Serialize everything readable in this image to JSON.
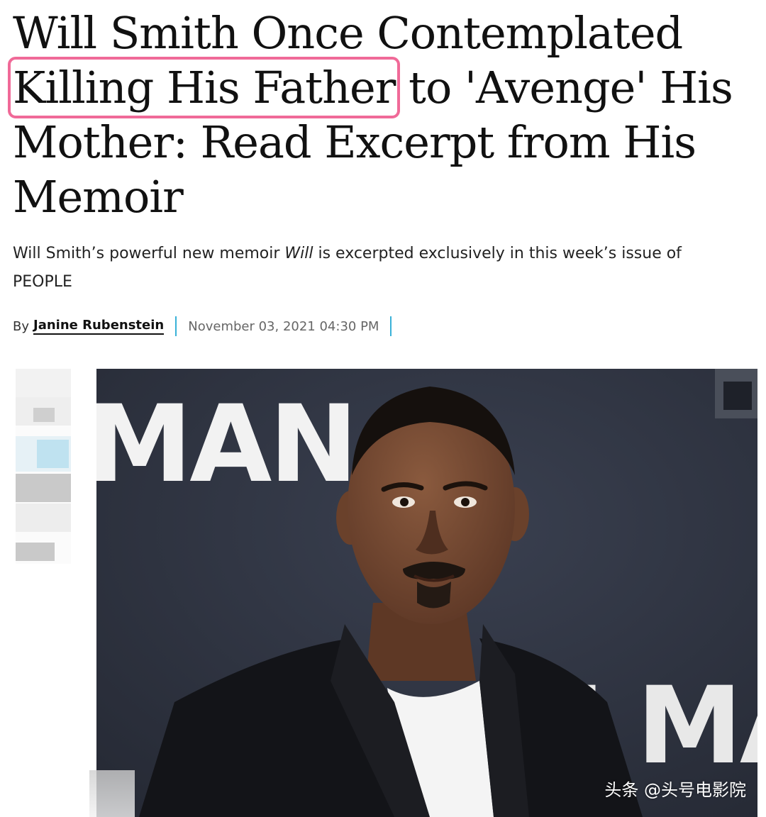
{
  "article": {
    "headline_part1": "Will Smith Once Contemplated ",
    "headline_highlight": "Killing His Father",
    "headline_part2": " to 'Avenge' His Mother: Read Excerpt from His Memoir",
    "dek_before": "Will Smith’s powerful new memoir ",
    "dek_italic": "Will",
    "dek_after": " is excerpted exclusively in this week’s issue of PEOPLE",
    "byline_prefix": "By",
    "author": "Janine Rubenstein",
    "date": "November 03, 2021 04:30 PM"
  },
  "photo": {
    "backdrop_text_top": "MAN",
    "backdrop_text_bottom": "NI MAN"
  },
  "watermark": "头条 @头号电影院",
  "colors": {
    "highlight": "#f06a98",
    "separator": "#39b1d8",
    "backdrop": "#2e3340"
  }
}
